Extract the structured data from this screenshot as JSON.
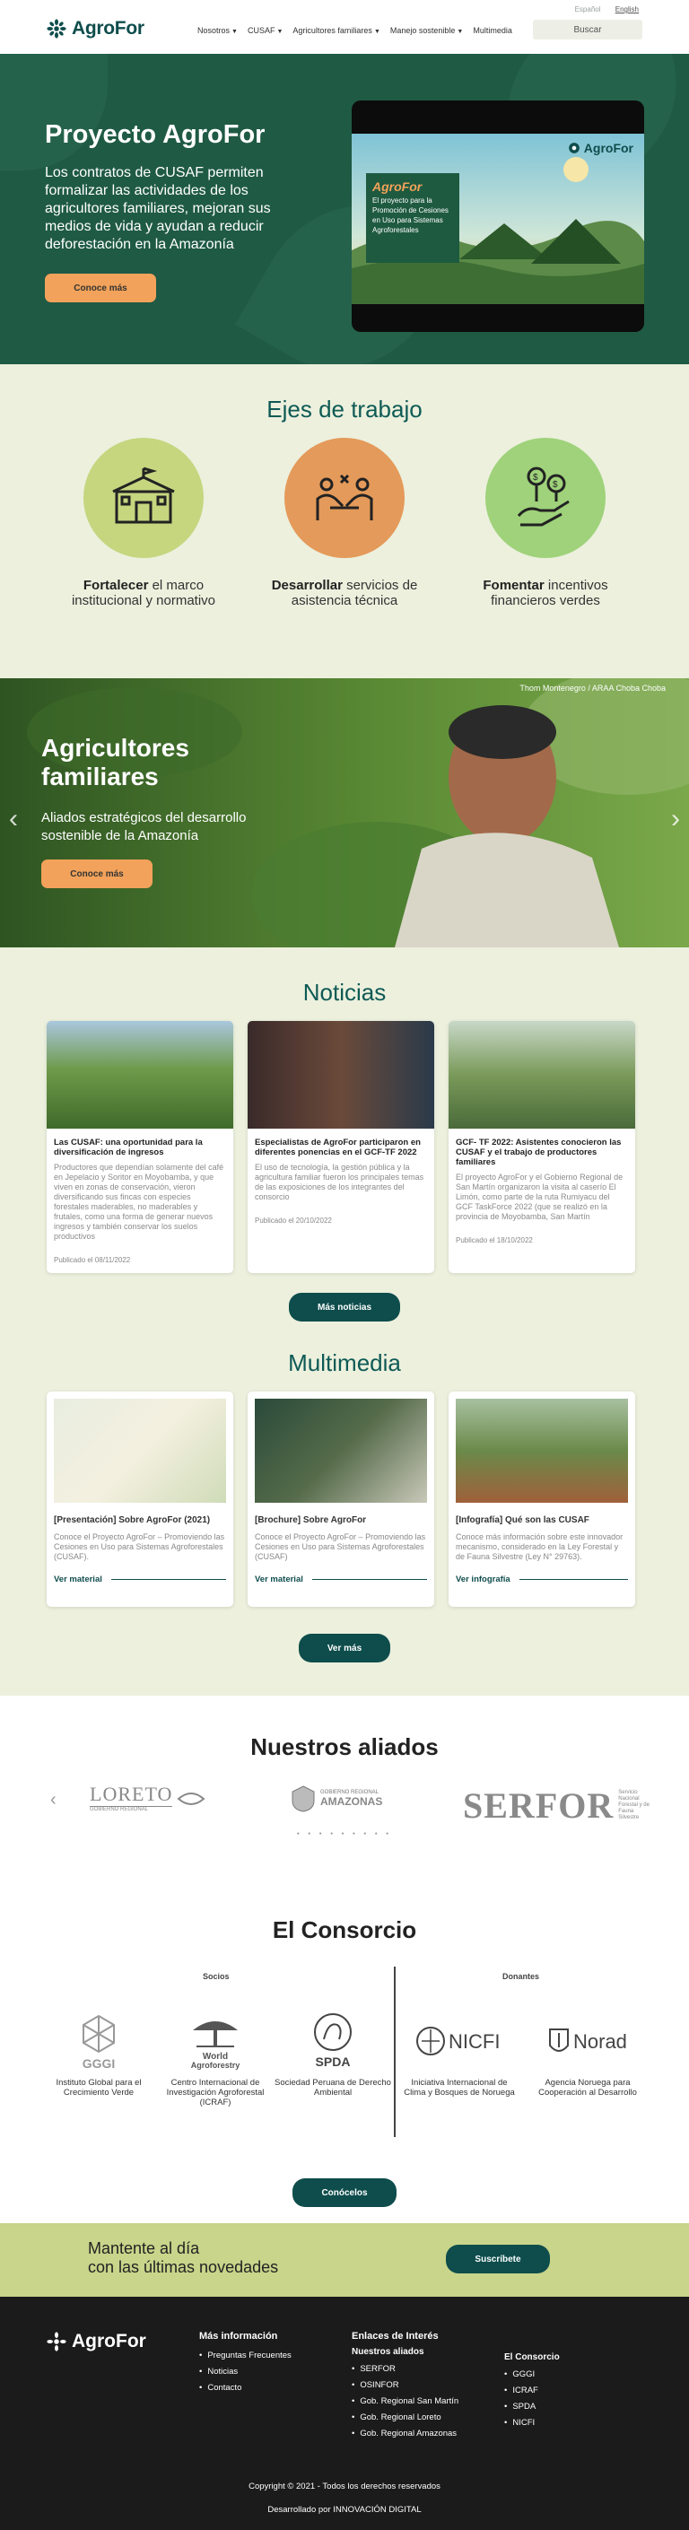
{
  "header": {
    "lang": [
      "Español",
      "English"
    ],
    "logo": "AgroFor",
    "nav": [
      {
        "label": "Nosotros",
        "caret": true
      },
      {
        "label": "CUSAF",
        "caret": true
      },
      {
        "label": "Agricultores familiares",
        "caret": true
      },
      {
        "label": "Manejo sostenible",
        "caret": true
      },
      {
        "label": "Multimedia",
        "caret": false
      }
    ],
    "search_label": "Buscar"
  },
  "hero": {
    "title": "Proyecto AgroFor",
    "description": "Los contratos de CUSAF permiten formalizar las actividades de los agricultores familiares, mejoran sus medios de vida y ayudan a reducir deforestación en la Amazonía",
    "button": "Conoce más",
    "video": {
      "logo": "AgroFor",
      "card_title": "AgroFor",
      "card_text": "El proyecto para la Promoción de Cesiones en Uso para Sistemas Agroforestales"
    }
  },
  "ejes": {
    "title": "Ejes de trabajo",
    "items": [
      {
        "bold": "Fortalecer",
        "rest": " el marco institucional y normativo",
        "color": "#c5d67f",
        "icon": "institution-icon"
      },
      {
        "bold": "Desarrollar",
        "rest": " servicios de asistencia técnica",
        "color": "#e49a5a",
        "icon": "assistance-icon"
      },
      {
        "bold": "Fomentar",
        "rest": " incentivos financieros verdes",
        "color": "#9fd27a",
        "icon": "finance-icon"
      }
    ]
  },
  "banner": {
    "credit": "Thom Montenegro / ARAA Choba Choba",
    "title": "Agricultores familiares",
    "subtitle": "Aliados estratégicos del desarrollo sostenible de la Amazonía",
    "button": "Conoce más"
  },
  "noticias": {
    "title": "Noticias",
    "items": [
      {
        "title": "Las CUSAF: una oportunidad para la diversificación de ingresos",
        "desc": "Productores que dependían solamente del café en Jepelacio y Soritor en Moyobamba, y que viven en zonas de conservación, vieron diversificando sus fincas con especies forestales maderables, no maderables y frutales, como una forma de generar nuevos ingresos y también conservar los suelos productivos",
        "date": "Publicado el 08/11/2022"
      },
      {
        "title": "Especialistas de AgroFor participaron en diferentes ponencias en el GCF-TF 2022",
        "desc": "El uso de tecnología, la gestión pública y la agricultura familiar fueron los principales temas de las exposiciones de los integrantes del consorcio",
        "date": "Publicado el 20/10/2022"
      },
      {
        "title": "GCF- TF 2022: Asistentes conocieron las CUSAF y el trabajo de productores familiares",
        "desc": "El proyecto AgroFor y el Gobierno Regional de San Martín organizaron la visita al caserío El Limón, como parte de la ruta Rumiyacu del GCF TaskForce 2022 (que se realizó en la provincia de Moyobamba, San Martín",
        "date": "Publicado el 18/10/2022"
      }
    ],
    "button": "Más noticias"
  },
  "multimedia": {
    "title": "Multimedia",
    "items": [
      {
        "title": "[Presentación] Sobre AgroFor (2021)",
        "desc": "Conoce el Proyecto AgroFor – Promoviendo las Cesiones en Uso para Sistemas Agroforestales (CUSAF).",
        "link": "Ver material"
      },
      {
        "title": "[Brochure] Sobre AgroFor",
        "desc": "Conoce el Proyecto AgroFor – Promoviendo las Cesiones en Uso para Sistemas Agroforestales (CUSAF)",
        "link": "Ver material"
      },
      {
        "title": "[Infografía] Qué son las CUSAF",
        "desc": "Conoce más información sobre este innovador mecanismo, considerado en la Ley Forestal y de Fauna Silvestre (Ley N° 29763).",
        "link": "Ver infografía"
      }
    ],
    "button": "Ver más"
  },
  "aliados": {
    "title": "Nuestros aliados",
    "logos": {
      "loreto": "LORETO",
      "loreto_sub": "GOBIERNO REGIONAL",
      "amazonas_top": "GOBIERNO REGIONAL",
      "amazonas": "AMAZONAS",
      "serfor": "SERFOR",
      "serfor_sub": "Servicio Nacional Forestal y de Fauna Silvestre"
    }
  },
  "consorcio": {
    "title": "El Consorcio",
    "socios_label": "Socios",
    "donantes_label": "Donantes",
    "orgs": [
      {
        "logo": "GGGI",
        "name": "Instituto Global para el Crecimiento Verde"
      },
      {
        "logo": "World Agroforestry",
        "name": "Centro Internacional de Investigación Agroforestal (ICRAF)"
      },
      {
        "logo": "SPDA",
        "name": "Sociedad Peruana de Derecho Ambiental"
      },
      {
        "logo": "NICFI",
        "name": "Iniciativa Internacional de Clima y Bosques de Noruega"
      },
      {
        "logo": "Norad",
        "name": "Agencia Noruega para Cooperación al Desarrollo"
      }
    ],
    "button": "Conócelos"
  },
  "newsletter": {
    "line1": "Mantente al día",
    "line2": "con las últimas novedades",
    "button": "Suscríbete"
  },
  "footer": {
    "logo": "AgroFor",
    "info_title": "Más información",
    "info_items": [
      "Preguntas Frecuentes",
      "Noticias",
      "Contacto"
    ],
    "links_title": "Enlaces de Interés",
    "aliados_title": "Nuestros aliados",
    "aliados_items": [
      "SERFOR",
      "OSINFOR",
      "Gob. Regional San Martín",
      "Gob. Regional Loreto",
      "Gob. Regional Amazonas"
    ],
    "consorcio_title": "El Consorcio",
    "consorcio_items": [
      "GGGI",
      "ICRAF",
      "SPDA",
      "NICFI"
    ],
    "copyright": "Copyright © 2021 - Todos los derechos reservados",
    "developer": "Desarrollado por INNOVACIÓN DIGITAL"
  }
}
